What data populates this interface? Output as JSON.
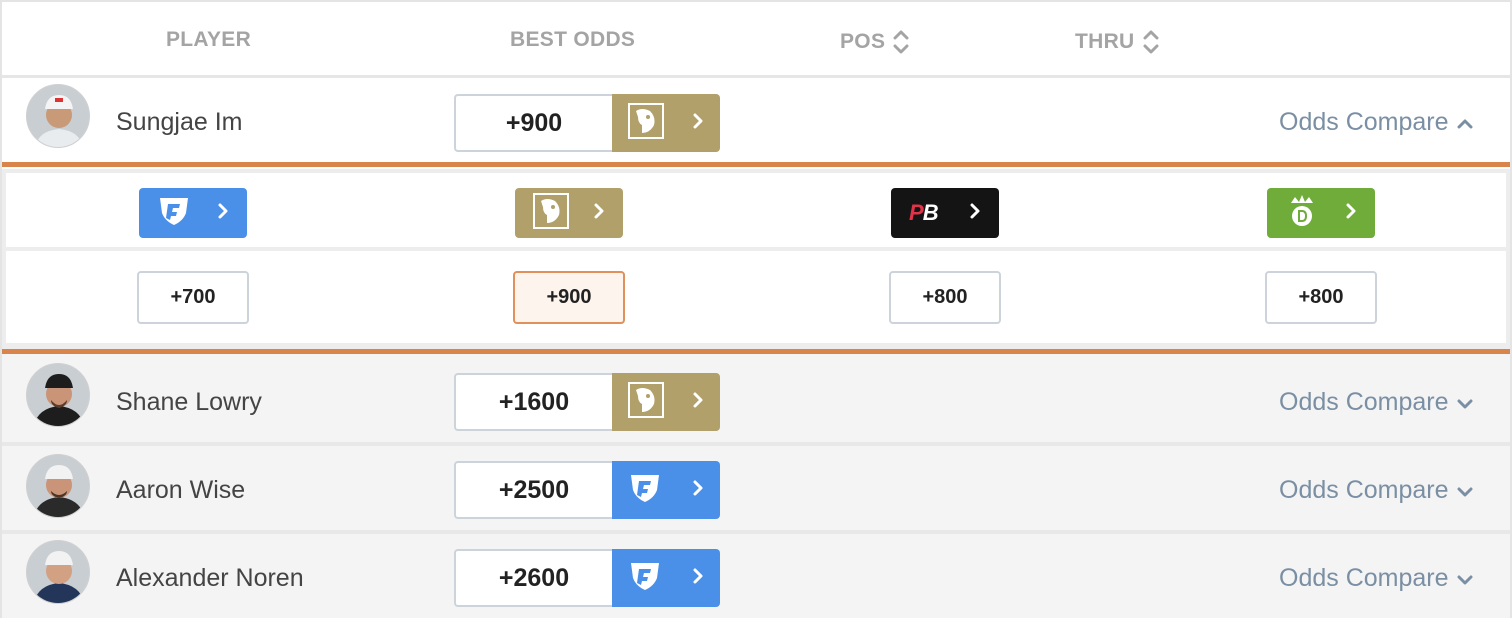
{
  "header": {
    "player": "PLAYER",
    "best_odds": "BEST ODDS",
    "pos": "POS",
    "thru": "THRU"
  },
  "players": [
    {
      "name": "Sungjae Im",
      "odds": "+900",
      "book": "BetMGM",
      "book_icon": "betmgm-lion-icon",
      "odds_compare": "Odds Compare",
      "expanded": true
    },
    {
      "name": "Shane Lowry",
      "odds": "+1600",
      "book": "BetMGM",
      "book_icon": "betmgm-lion-icon",
      "odds_compare": "Odds Compare",
      "expanded": false
    },
    {
      "name": "Aaron Wise",
      "odds": "+2500",
      "book": "FanDuel",
      "book_icon": "fanduel-shield-icon",
      "odds_compare": "Odds Compare",
      "expanded": false
    },
    {
      "name": "Alexander Noren",
      "odds": "+2600",
      "book": "FanDuel",
      "book_icon": "fanduel-shield-icon",
      "odds_compare": "Odds Compare",
      "expanded": false
    }
  ],
  "compare": {
    "books": [
      {
        "name": "FanDuel",
        "icon": "fanduel-shield-icon",
        "odds": "+700",
        "best": false
      },
      {
        "name": "BetMGM",
        "icon": "betmgm-lion-icon",
        "odds": "+900",
        "best": true
      },
      {
        "name": "PointsBet",
        "icon": "pointsbet-logo",
        "logo_text_p": "P",
        "logo_text_b": "B",
        "odds": "+800",
        "best": false
      },
      {
        "name": "DraftKings",
        "icon": "draftkings-crown-icon",
        "odds": "+800",
        "best": false
      }
    ]
  },
  "colors": {
    "fanduel": "#4a90e9",
    "betmgm": "#b1a069",
    "pointsbet": "#141414",
    "draftkings": "#6fac3a",
    "accent_orange": "#d9844a",
    "link": "#7a8fa3"
  }
}
